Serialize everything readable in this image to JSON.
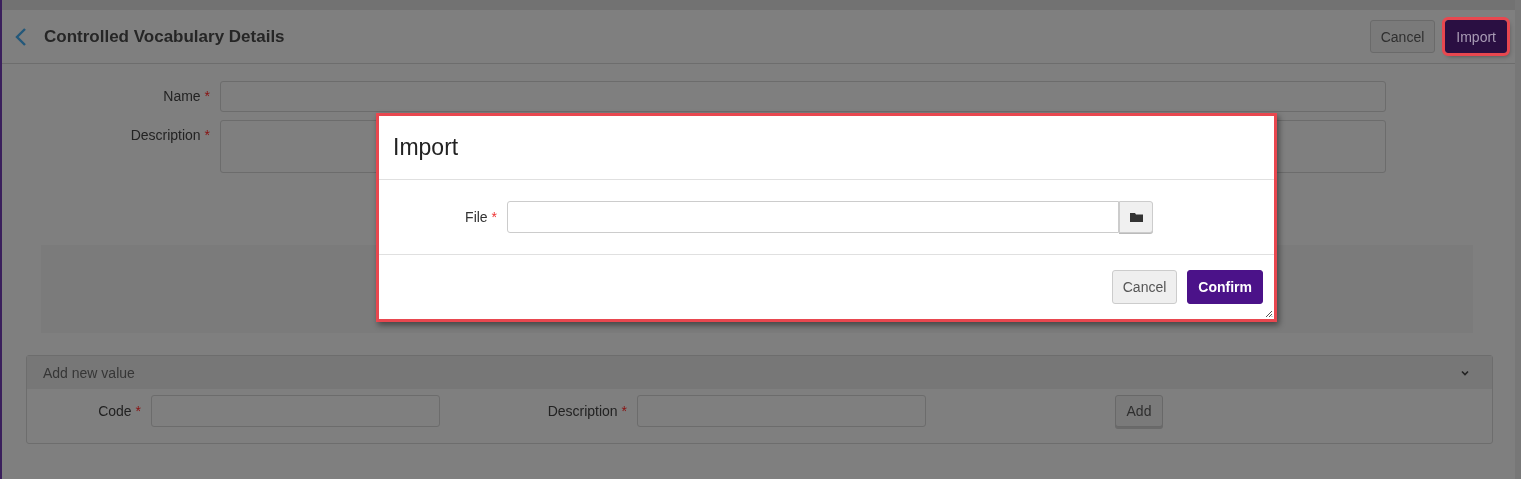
{
  "header": {
    "title": "Controlled Vocabulary Details",
    "buttons": [
      {
        "label": "Cancel",
        "kind": "secondary",
        "highlighted": false
      },
      {
        "label": "Import",
        "kind": "primary",
        "highlighted": true
      }
    ]
  },
  "form": {
    "fields": [
      {
        "label": "Name",
        "mark": "*",
        "kind": "input"
      },
      {
        "label": "Description",
        "mark": "*",
        "kind": "textarea"
      }
    ]
  },
  "add_new_value": {
    "title": "Add new value",
    "expanded": true,
    "fields": [
      {
        "label": "Code",
        "mark": "*"
      },
      {
        "label": "Description",
        "mark": "*"
      }
    ],
    "button": "Add"
  },
  "dialog": {
    "title": "Import",
    "highlighted": true,
    "field": {
      "label": "File",
      "mark": "*"
    },
    "buttons": [
      {
        "label": "Cancel",
        "kind": "secondary"
      },
      {
        "label": "Confirm",
        "kind": "primary"
      }
    ]
  }
}
